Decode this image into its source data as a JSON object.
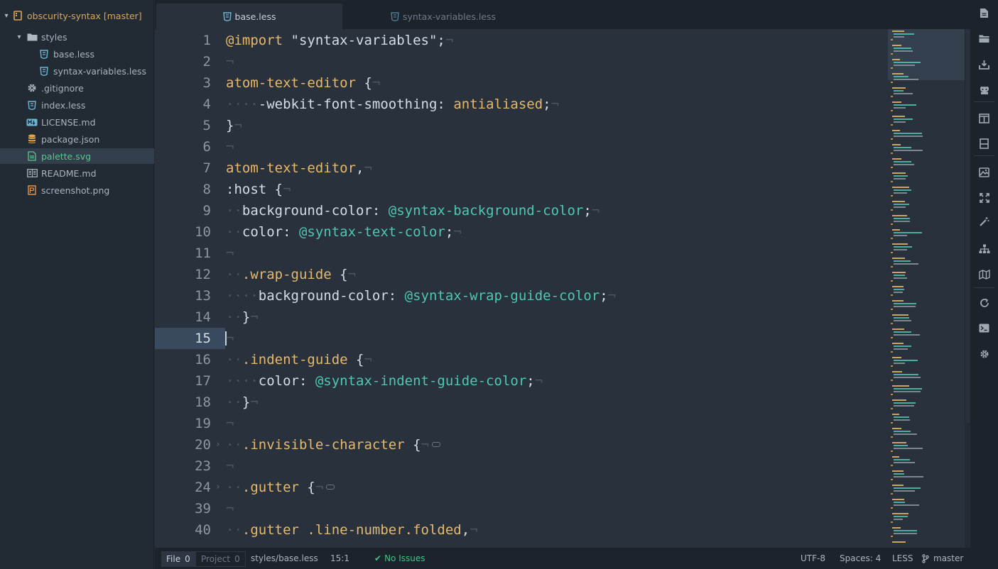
{
  "tree": {
    "root": "obscurity-syntax [master]",
    "items": [
      {
        "label": "styles",
        "icon": "folder-icon",
        "indent": 1,
        "expanded": true
      },
      {
        "label": "base.less",
        "icon": "css-file-icon",
        "indent": 2
      },
      {
        "label": "syntax-variables.less",
        "icon": "css-file-icon",
        "indent": 2
      },
      {
        "label": ".gitignore",
        "icon": "gear-icon",
        "indent": 1
      },
      {
        "label": "index.less",
        "icon": "css-file-icon",
        "indent": 1
      },
      {
        "label": "LICENSE.md",
        "icon": "markdown-icon",
        "indent": 1
      },
      {
        "label": "package.json",
        "icon": "database-icon",
        "indent": 1
      },
      {
        "label": "palette.svg",
        "icon": "image-file-icon",
        "indent": 1,
        "selected": true
      },
      {
        "label": "README.md",
        "icon": "book-icon",
        "indent": 1
      },
      {
        "label": "screenshot.png",
        "icon": "picture-icon",
        "indent": 1
      }
    ]
  },
  "tabs": [
    {
      "label": "base.less",
      "active": true
    },
    {
      "label": "syntax-variables.less",
      "active": false
    }
  ],
  "editor": {
    "lines": [
      {
        "n": "1",
        "tokens": [
          [
            "kw",
            "@import"
          ],
          [
            "str",
            " \"syntax-variables\";"
          ],
          [
            "inv",
            "¬"
          ]
        ]
      },
      {
        "n": "2",
        "tokens": [
          [
            "inv",
            "¬"
          ]
        ]
      },
      {
        "n": "3",
        "tokens": [
          [
            "sel",
            "atom-text-editor"
          ],
          [
            "str",
            " {"
          ],
          [
            "inv",
            "¬"
          ]
        ]
      },
      {
        "n": "4",
        "tokens": [
          [
            "inv",
            "····"
          ],
          [
            "prop",
            "-webkit-font-smoothing: "
          ],
          [
            "val",
            "antialiased"
          ],
          [
            "str",
            ";"
          ],
          [
            "inv",
            "¬"
          ]
        ]
      },
      {
        "n": "5",
        "tokens": [
          [
            "str",
            "}"
          ],
          [
            "inv",
            "¬"
          ]
        ]
      },
      {
        "n": "6",
        "tokens": [
          [
            "inv",
            "¬"
          ]
        ]
      },
      {
        "n": "7",
        "tokens": [
          [
            "sel",
            "atom-text-editor"
          ],
          [
            "str",
            ","
          ],
          [
            "inv",
            "¬"
          ]
        ]
      },
      {
        "n": "8",
        "tokens": [
          [
            "str",
            ":host {"
          ],
          [
            "inv",
            "¬"
          ]
        ]
      },
      {
        "n": "9",
        "tokens": [
          [
            "inv",
            "··"
          ],
          [
            "prop",
            "background-color: "
          ],
          [
            "var",
            "@syntax-background-color"
          ],
          [
            "str",
            ";"
          ],
          [
            "inv",
            "¬"
          ]
        ]
      },
      {
        "n": "10",
        "tokens": [
          [
            "inv",
            "··"
          ],
          [
            "prop",
            "color: "
          ],
          [
            "var",
            "@syntax-text-color"
          ],
          [
            "str",
            ";"
          ],
          [
            "inv",
            "¬"
          ]
        ]
      },
      {
        "n": "11",
        "tokens": [
          [
            "inv",
            "¬"
          ]
        ]
      },
      {
        "n": "12",
        "tokens": [
          [
            "inv",
            "··"
          ],
          [
            "sel",
            ".wrap-guide"
          ],
          [
            "str",
            " {"
          ],
          [
            "inv",
            "¬"
          ]
        ]
      },
      {
        "n": "13",
        "tokens": [
          [
            "inv",
            "····"
          ],
          [
            "prop",
            "background-color: "
          ],
          [
            "var",
            "@syntax-wrap-guide-color"
          ],
          [
            "str",
            ";"
          ],
          [
            "inv",
            "¬"
          ]
        ]
      },
      {
        "n": "14",
        "tokens": [
          [
            "inv",
            "··"
          ],
          [
            "str",
            "}"
          ],
          [
            "inv",
            "¬"
          ]
        ]
      },
      {
        "n": "15",
        "tokens": [
          [
            "inv",
            "¬"
          ]
        ],
        "cursor": true
      },
      {
        "n": "16",
        "tokens": [
          [
            "inv",
            "··"
          ],
          [
            "sel",
            ".indent-guide"
          ],
          [
            "str",
            " {"
          ],
          [
            "inv",
            "¬"
          ]
        ]
      },
      {
        "n": "17",
        "tokens": [
          [
            "inv",
            "····"
          ],
          [
            "prop",
            "color: "
          ],
          [
            "var",
            "@syntax-indent-guide-color"
          ],
          [
            "str",
            ";"
          ],
          [
            "inv",
            "¬"
          ]
        ]
      },
      {
        "n": "18",
        "tokens": [
          [
            "inv",
            "··"
          ],
          [
            "str",
            "}"
          ],
          [
            "inv",
            "¬"
          ]
        ]
      },
      {
        "n": "19",
        "tokens": [
          [
            "inv",
            "¬"
          ]
        ]
      },
      {
        "n": "20",
        "tokens": [
          [
            "inv",
            "··"
          ],
          [
            "sel",
            ".invisible-character"
          ],
          [
            "str",
            " {"
          ],
          [
            "inv",
            "¬"
          ]
        ],
        "folded": true
      },
      {
        "n": "23",
        "tokens": [
          [
            "inv",
            "¬"
          ]
        ]
      },
      {
        "n": "24",
        "tokens": [
          [
            "inv",
            "··"
          ],
          [
            "sel",
            ".gutter"
          ],
          [
            "str",
            " {"
          ],
          [
            "inv",
            "¬"
          ]
        ],
        "folded": true
      },
      {
        "n": "39",
        "tokens": [
          [
            "inv",
            "¬"
          ]
        ]
      },
      {
        "n": "40",
        "tokens": [
          [
            "inv",
            "··"
          ],
          [
            "sel",
            ".gutter .line-number.folded"
          ],
          [
            "str",
            ","
          ],
          [
            "inv",
            "¬"
          ]
        ]
      }
    ]
  },
  "toolbar": {
    "icons": [
      "new-file-icon",
      "open-folder-icon",
      "download-icon",
      "github-icon",
      "split-vertical-icon",
      "split-horizontal-icon",
      "image-edit-icon",
      "fullscreen-icon",
      "magic-wand-icon",
      "sitemap-icon",
      "map-icon",
      "refresh-icon",
      "terminal-icon",
      "settings-gear-icon"
    ]
  },
  "status": {
    "file_tab": "File",
    "file_count": "0",
    "project_tab": "Project",
    "project_count": "0",
    "path": "styles/base.less",
    "cursor_pos": "15:1",
    "issues": "No Issues",
    "encoding": "UTF-8",
    "indent": "Spaces: 4",
    "grammar": "LESS",
    "branch": "master"
  },
  "colors": {
    "keyword": "#e7b96a",
    "variable": "#4fc7b3",
    "text": "#d5dde5",
    "success": "#3fc389",
    "root_label": "#d9a75a"
  }
}
